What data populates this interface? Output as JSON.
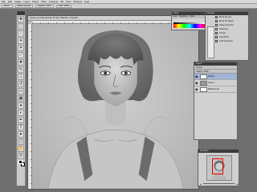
{
  "menubar": {
    "items": [
      "File",
      "Edit",
      "Image",
      "Layer",
      "Select",
      "Filter",
      "Analysis",
      "3D",
      "View",
      "Window",
      "Help"
    ]
  },
  "options": {
    "chips": [
      "Brush:",
      "Mode: Normal",
      "Opacity: 100%",
      "Flow: 100%"
    ]
  },
  "document": {
    "title": "Hotel_portrait.psd @ 33.3% (Sketch, Gray/8)"
  },
  "color_panel": {
    "title": "Color",
    "tabs": [
      "Color",
      "Swatches",
      "Styles"
    ]
  },
  "brush_panel": {
    "title": "Brushes",
    "items": [
      "Brush Presets",
      "Brush Tip Shape",
      "Shape Dynamics",
      "Scattering",
      "Texture",
      "Dual Brush",
      "Color Dynamics"
    ]
  },
  "layers_panel": {
    "title": "Layers",
    "blend": "Normal",
    "opacity": "Opacity: 100%",
    "layers": [
      {
        "name": "Sketch",
        "active": true
      },
      {
        "name": "Layer 1",
        "active": false
      },
      {
        "name": "Background",
        "active": false
      }
    ]
  },
  "navigator_panel": {
    "title": "Navigator"
  },
  "colors": {
    "accent_selection": "#9fb4d6",
    "nav_viewbox": "#ee0000"
  }
}
